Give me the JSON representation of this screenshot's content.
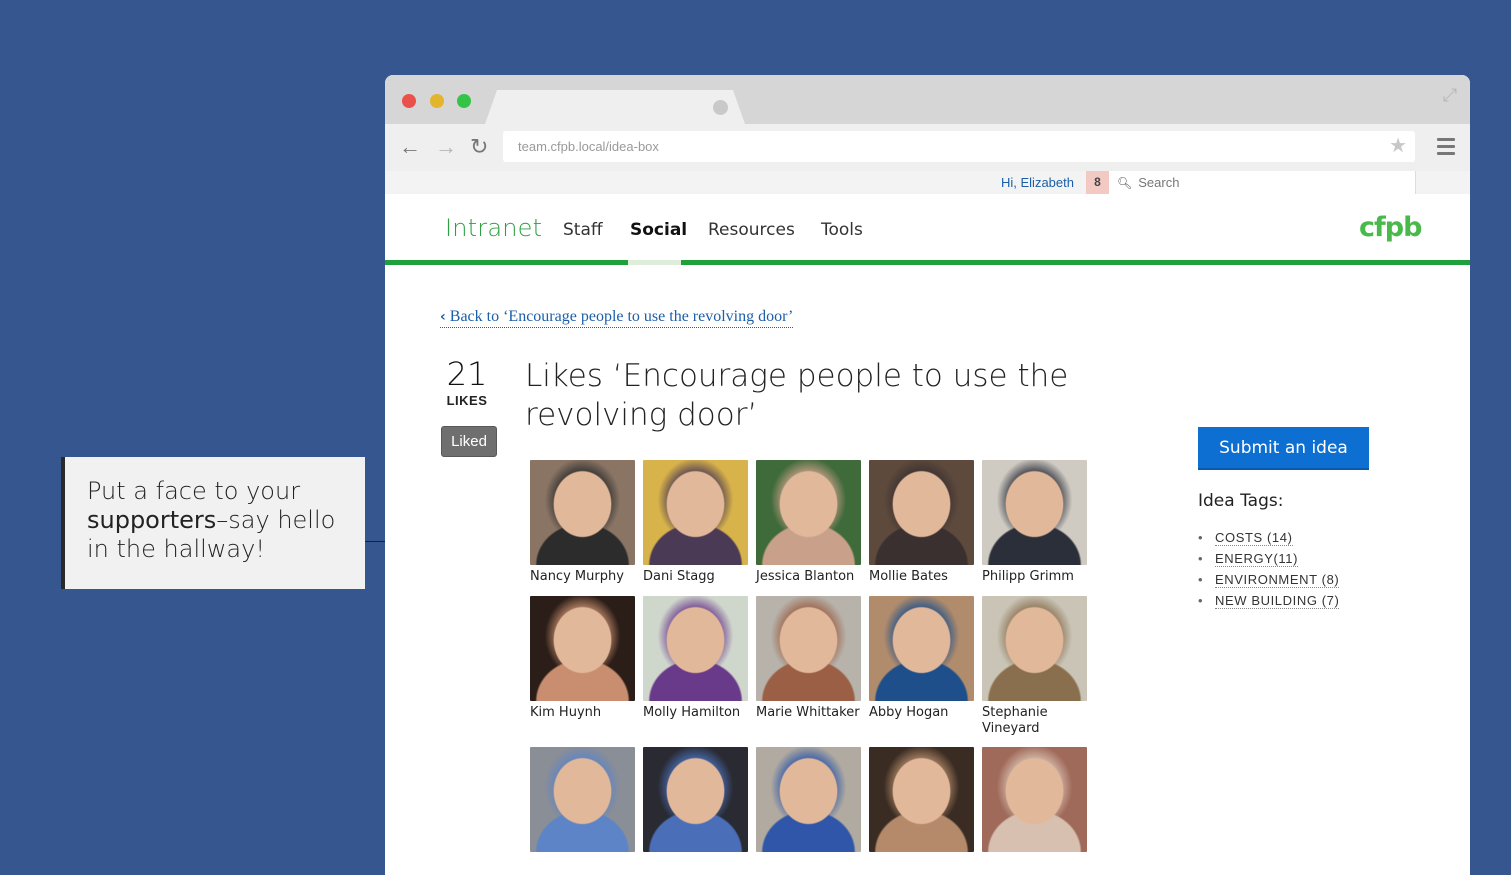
{
  "callout": {
    "text_plain": "Put a face to your ",
    "text_bold": "supporters",
    "text_rest": "–say hello in the hallway!"
  },
  "browser": {
    "url": "team.cfpb.local/idea-box"
  },
  "utility": {
    "greeting": "Hi, Elizabeth",
    "notifications": "8",
    "search_placeholder": "Search"
  },
  "nav": {
    "brand": "Intranet",
    "items": [
      {
        "label": "Staff"
      },
      {
        "label": "Social",
        "active": true
      },
      {
        "label": "Resources"
      },
      {
        "label": "Tools"
      }
    ],
    "logo": "cfpb"
  },
  "content": {
    "back_link": "Back to ‘Encourage people to use the revolving door’",
    "likes_count": "21",
    "likes_label": "LIKES",
    "liked_button": "Liked",
    "title": "Likes ‘Encourage people to use the revolving door’"
  },
  "people": [
    {
      "name": "Nancy Murphy",
      "colors": [
        "#8a7565",
        "#2c2c2c"
      ]
    },
    {
      "name": "Dani Stagg",
      "colors": [
        "#d8b24a",
        "#4b3a55"
      ]
    },
    {
      "name": "Jessica Blanton",
      "colors": [
        "#3f6a3a",
        "#c9a08a"
      ]
    },
    {
      "name": "Mollie Bates",
      "colors": [
        "#5e4a3c",
        "#3a3030"
      ]
    },
    {
      "name": "Philipp Grimm",
      "colors": [
        "#cfcac2",
        "#2b2f3a"
      ]
    },
    {
      "name": "Kim Huynh",
      "colors": [
        "#2b1d18",
        "#c88e6f"
      ]
    },
    {
      "name": "Molly Hamilton",
      "colors": [
        "#cfd6cc",
        "#6a3a8a"
      ]
    },
    {
      "name": "Marie Whittaker",
      "colors": [
        "#b7b2aa",
        "#9a5f45"
      ]
    },
    {
      "name": "Abby Hogan",
      "colors": [
        "#b08c6c",
        "#1f4f8a"
      ]
    },
    {
      "name": "Stephanie Vineyard",
      "colors": [
        "#c9c4b6",
        "#8a6f4e"
      ]
    },
    {
      "name": "",
      "colors": [
        "#8a8e96",
        "#5d84c6"
      ]
    },
    {
      "name": "",
      "colors": [
        "#2a2a33",
        "#4a6fb8"
      ]
    },
    {
      "name": "",
      "colors": [
        "#b0aaa0",
        "#2f56a8"
      ]
    },
    {
      "name": "",
      "colors": [
        "#3a2c22",
        "#b48a6a"
      ]
    },
    {
      "name": "",
      "colors": [
        "#a06a5a",
        "#d8c0b0"
      ]
    }
  ],
  "sidebar": {
    "submit_label": "Submit an idea",
    "tags_heading": "Idea Tags:",
    "tags": [
      {
        "label": "COSTS (14)"
      },
      {
        "label": "ENERGY(11)"
      },
      {
        "label": "ENVIRONMENT (8)"
      },
      {
        "label": "NEW BUILDING (7)"
      }
    ]
  },
  "colors": {
    "background": "#36568f",
    "brand_green": "#20a03a",
    "button_blue": "#0d6fd1",
    "link_blue": "#1c5fa8"
  }
}
